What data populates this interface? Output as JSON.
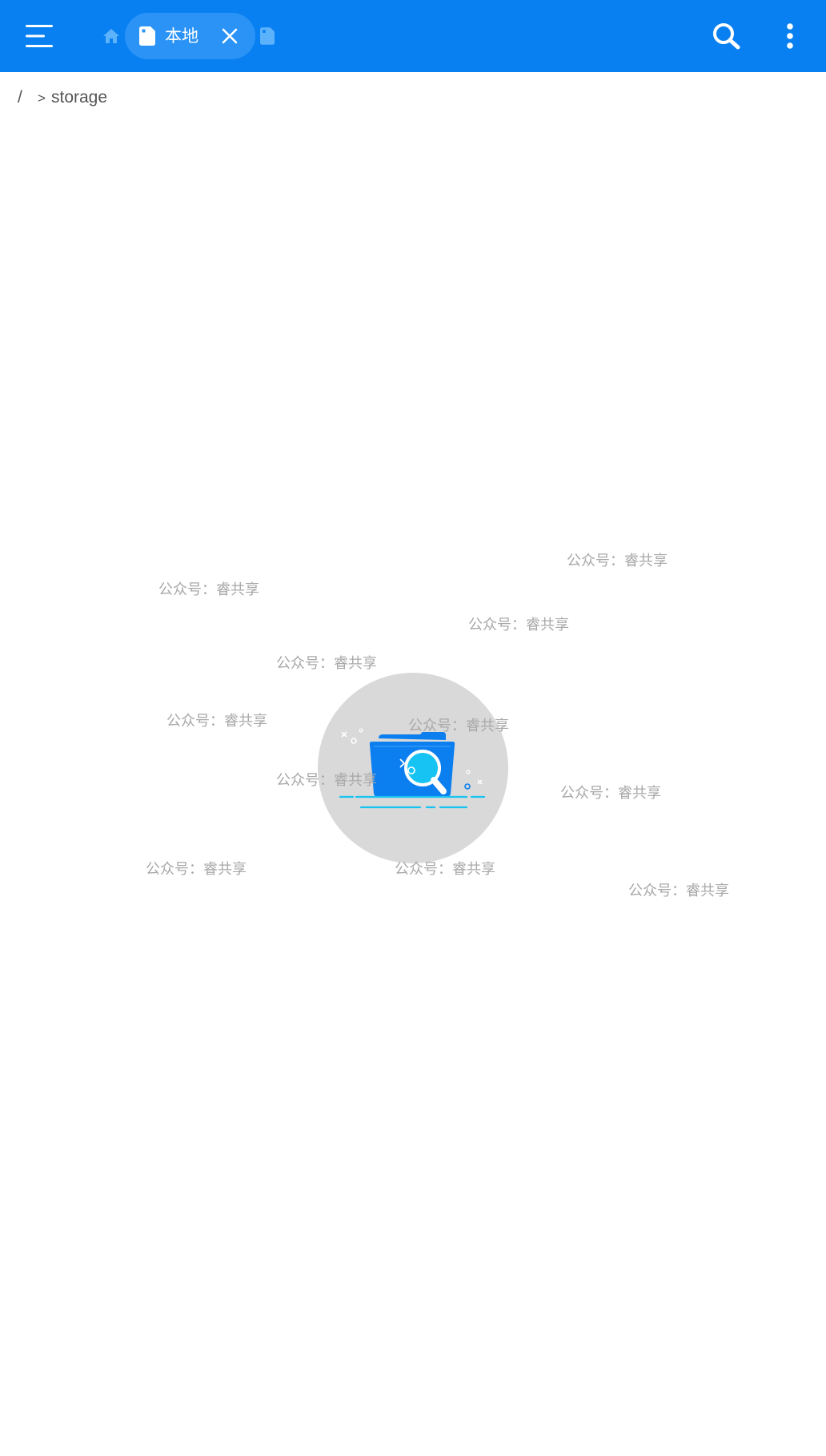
{
  "colors": {
    "appbar": "#0880f2",
    "tab_active_bg": "#2a93f5",
    "text_muted": "#555555",
    "empty_circle": "#d9d9d9",
    "illustration_blue": "#0b7ef0",
    "illustration_cyan": "#16c3f2",
    "watermark": "#a8a8a8"
  },
  "appbar": {
    "menu_icon": "hamburger-menu-icon",
    "home_icon": "home-icon",
    "active_tab": {
      "icon": "document-icon",
      "label": "本地",
      "close_icon": "close-icon"
    },
    "next_tab_icon": "document-icon",
    "search_icon": "search-icon",
    "more_icon": "more-vertical-icon"
  },
  "breadcrumb": {
    "root": "/",
    "separator": ">",
    "current": "storage"
  },
  "empty_state": {
    "illustration": "empty-folder-search-illustration"
  },
  "watermarks": [
    "公众号：睿共享",
    "公众号：睿共享",
    "公众号：睿共享",
    "公众号：睿共享",
    "公众号：睿共享",
    "公众号：睿共享",
    "公众号：睿共享",
    "公众号：睿共享",
    "公众号：睿共享",
    "公众号：睿共享",
    "公众号：睿共享"
  ]
}
